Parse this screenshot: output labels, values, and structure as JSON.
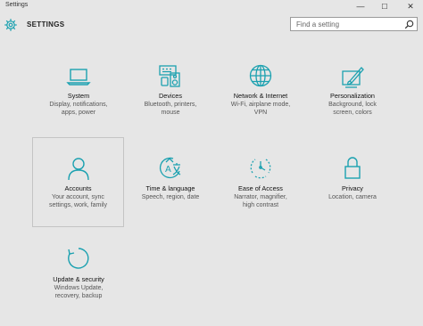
{
  "window": {
    "title": "Settings",
    "minimize": "—",
    "maximize": "☐",
    "close": "✕"
  },
  "header": {
    "app_name": "SETTINGS"
  },
  "search": {
    "placeholder": "Find a setting"
  },
  "accent": "#1ba1b0",
  "tiles": [
    {
      "name": "System",
      "desc": [
        "Display, notifications,",
        "apps, power"
      ],
      "icon": "laptop-icon"
    },
    {
      "name": "Devices",
      "desc": [
        "Bluetooth, printers,",
        "mouse"
      ],
      "icon": "keyboard-speaker-icon"
    },
    {
      "name": "Network & Internet",
      "desc": [
        "Wi-Fi, airplane mode,",
        "VPN"
      ],
      "icon": "globe-icon"
    },
    {
      "name": "Personalization",
      "desc": [
        "Background, lock",
        "screen, colors"
      ],
      "icon": "paint-icon"
    },
    {
      "name": "Accounts",
      "desc": [
        "Your account, sync",
        "settings, work, family"
      ],
      "icon": "person-icon"
    },
    {
      "name": "Time & language",
      "desc": [
        "Speech, region, date"
      ],
      "icon": "time-language-icon"
    },
    {
      "name": "Ease of Access",
      "desc": [
        "Narrator, magnifier,",
        "high contrast"
      ],
      "icon": "ease-of-access-icon"
    },
    {
      "name": "Privacy",
      "desc": [
        "Location, camera"
      ],
      "icon": "lock-icon"
    },
    {
      "name": "Update & security",
      "desc": [
        "Windows Update,",
        "recovery, backup"
      ],
      "icon": "refresh-icon"
    }
  ]
}
